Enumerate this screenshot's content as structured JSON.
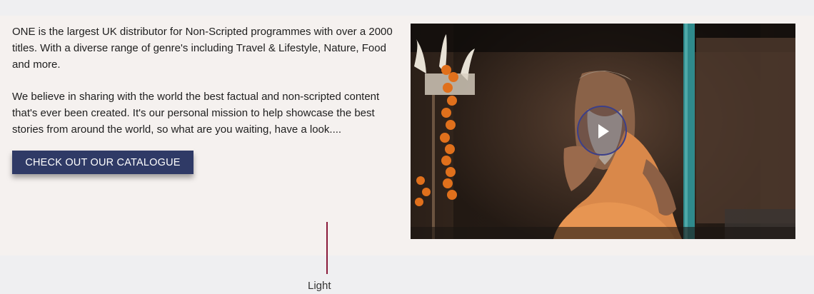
{
  "intro": {
    "paragraph_1": "ONE is the largest UK distributor for Non-Scripted programmes with over a 2000 titles. With a diverse range of genre's including Travel & Lifestyle, Nature, Food and more.",
    "paragraph_2": "We believe in sharing with the world the best factual and non-scripted content that's ever been created. It's our personal mission to help showcase the best stories from around the world, so what are you waiting, have a look....",
    "cta_label": "CHECK OUT OUR CATALOGUE"
  },
  "video": {
    "play_icon": "play-icon",
    "thumbnail": "sadhu-holy-man-photo"
  },
  "annotation": {
    "label": "Light"
  },
  "colors": {
    "cta_bg": "#2f3a66",
    "band_bg": "#f5f1ef",
    "page_bg": "#efeff1",
    "guide_line": "#8a1a3a"
  }
}
